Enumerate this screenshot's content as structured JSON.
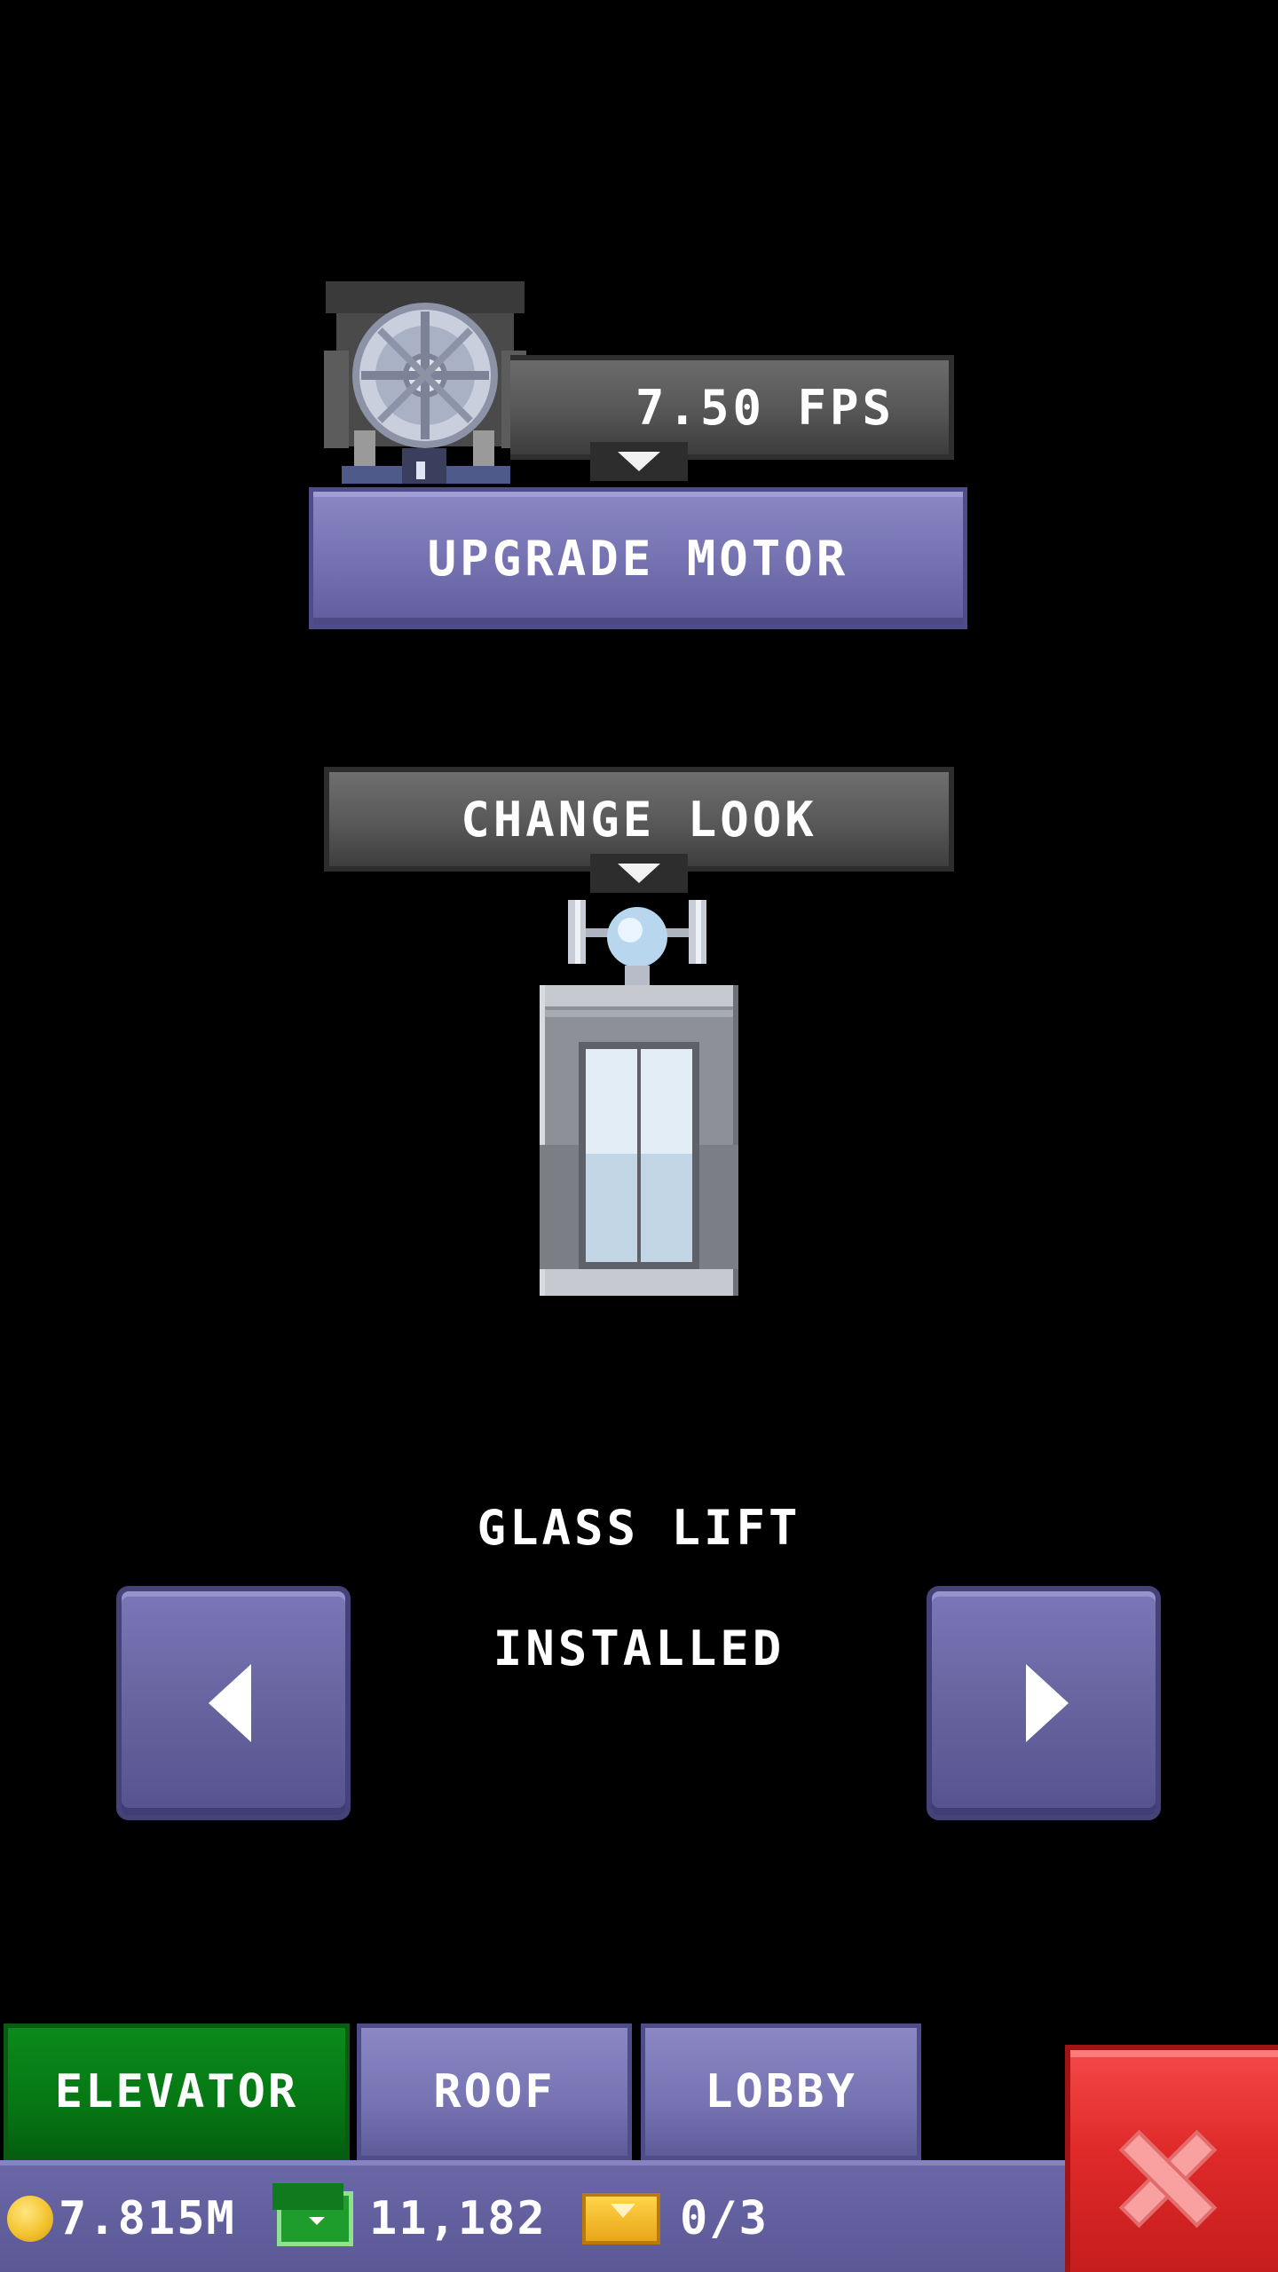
{
  "motor": {
    "speed_label": "7.50 FPS",
    "upgrade_label": "UPGRADE MOTOR"
  },
  "look": {
    "change_label": "CHANGE LOOK",
    "model_name": "GLASS LIFT",
    "model_status": "INSTALLED"
  },
  "tabs": [
    {
      "label": "ELEVATOR",
      "active": true
    },
    {
      "label": "ROOF",
      "active": false
    },
    {
      "label": "LOBBY",
      "active": false
    }
  ],
  "status": {
    "coins": "7.815M",
    "bux": "11,182",
    "tickets": "0/3"
  },
  "colors": {
    "active_tab": "#067714",
    "button_purple": "#7673b2",
    "close_red": "#e02a2a"
  },
  "icons": {
    "motor": "motor-icon",
    "elevator": "elevator-icon",
    "coin": "coin-icon",
    "bux": "bux-icon",
    "ticket": "ticket-icon",
    "close": "close-icon",
    "prev": "arrow-left-icon",
    "next": "arrow-right-icon"
  }
}
